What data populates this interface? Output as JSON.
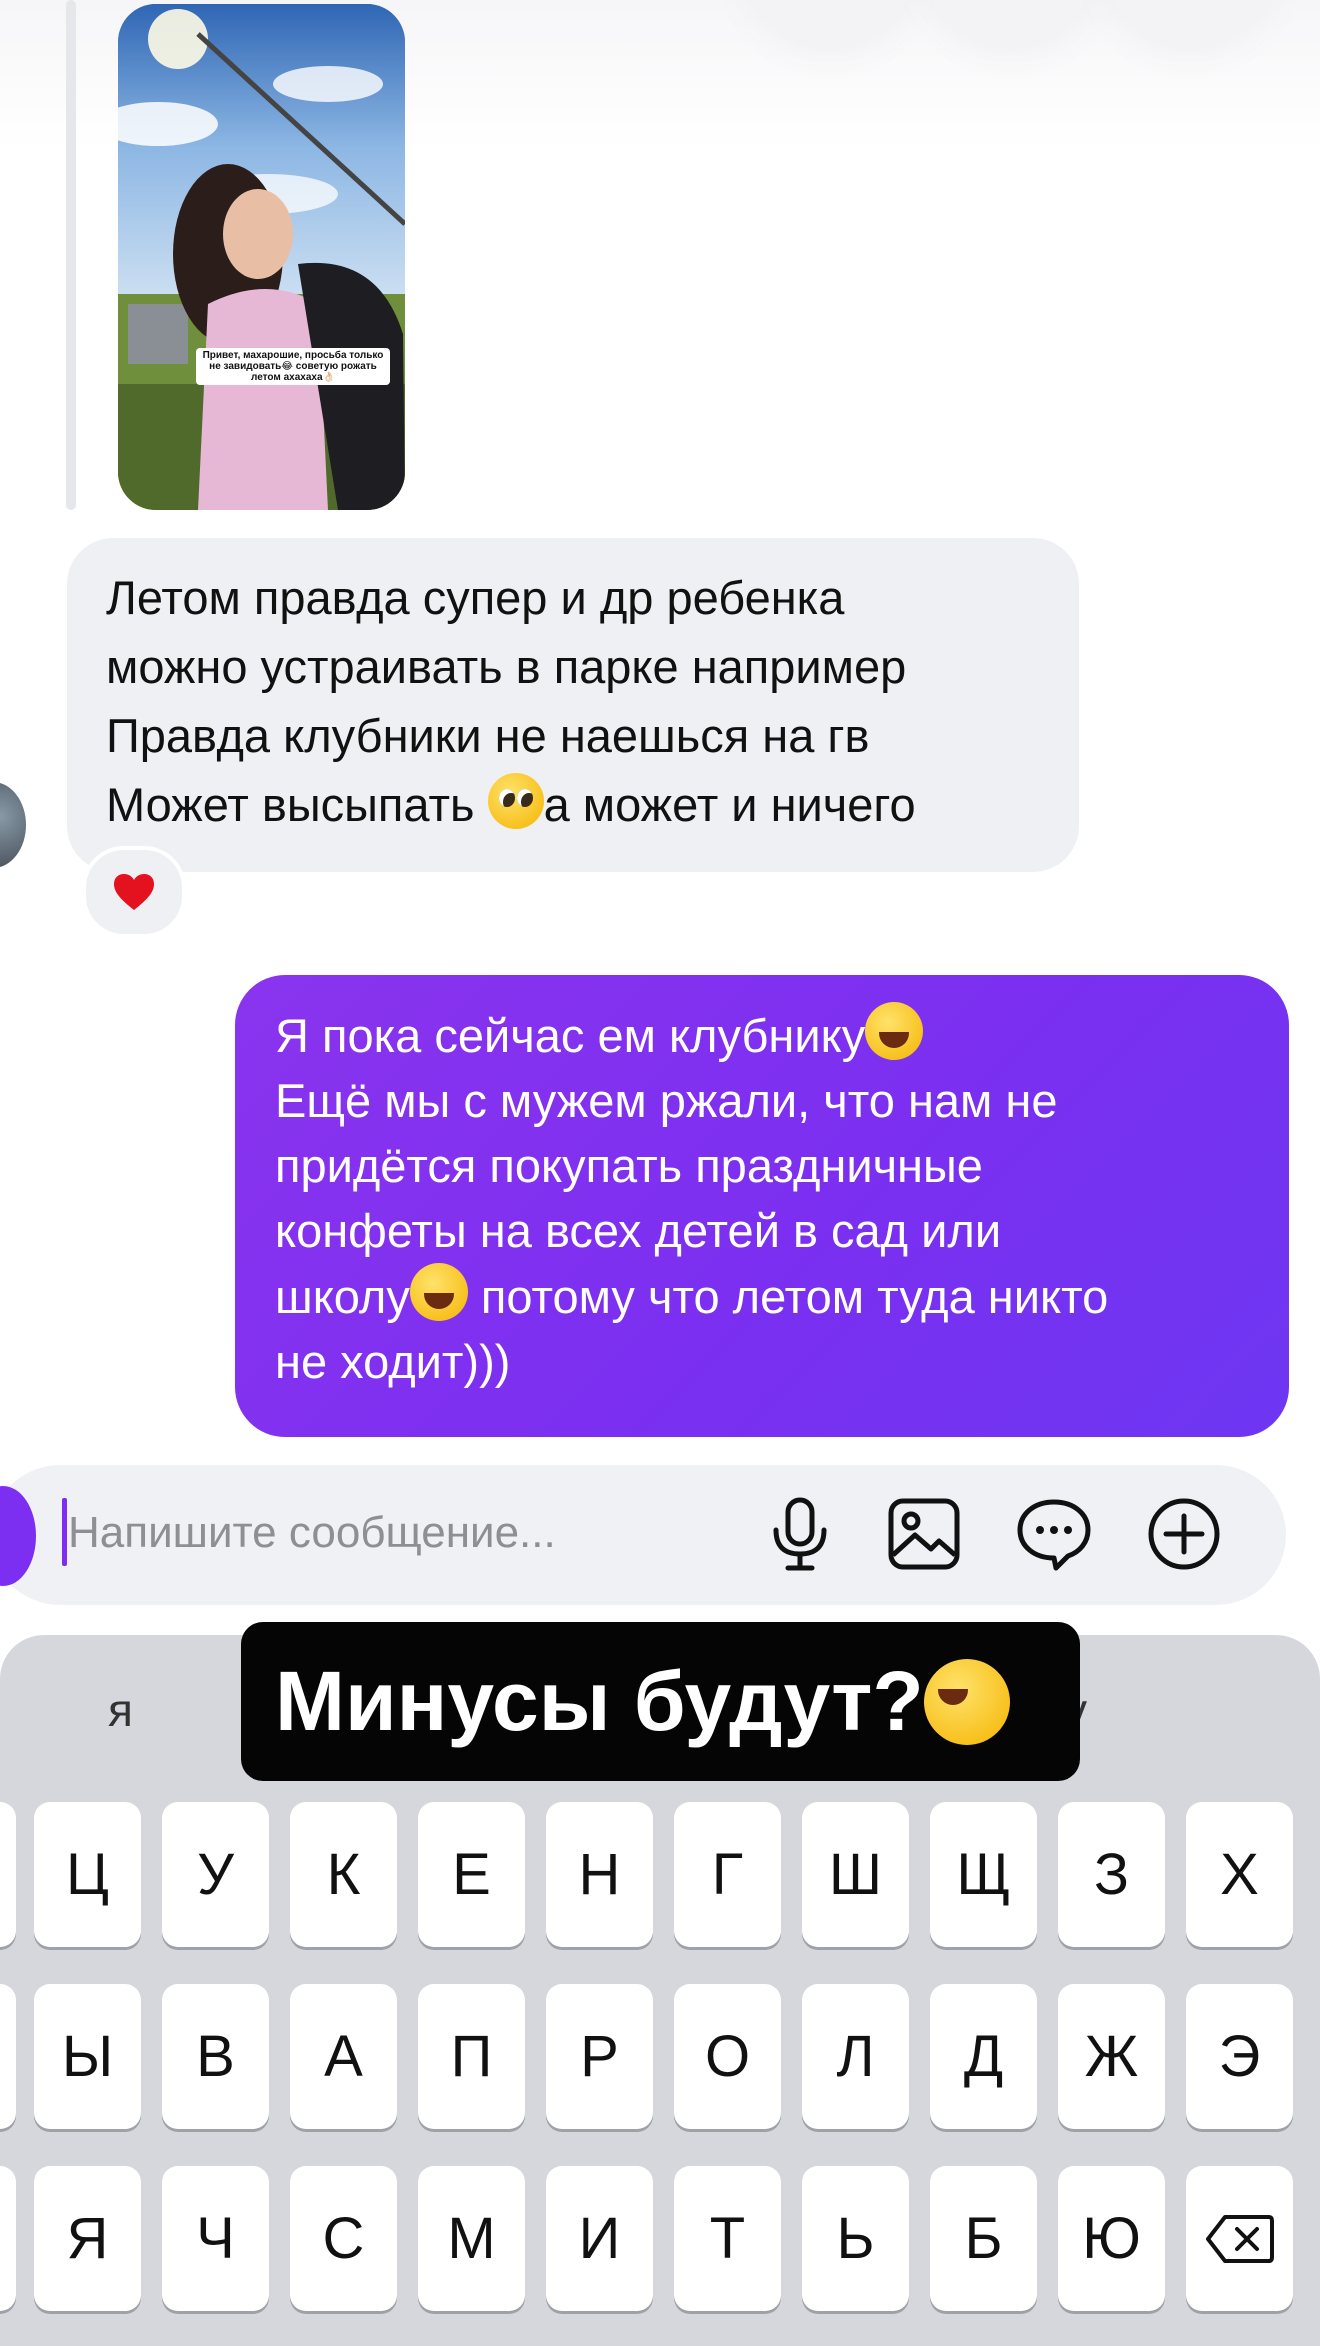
{
  "story": {
    "caption": "Привет, махарошие, просьба только не завидовать😂 советую рожать летом ахахаха👌🏻"
  },
  "received_message": {
    "lines": [
      "Летом правда супер и др ребенка",
      "можно устраивать в парке например",
      "Правда клубники не наешься на гв"
    ],
    "last_line_before": "Может высыпать ",
    "last_line_emoji": "pleading-face-emoji",
    "last_line_after": "а может и ничего",
    "reaction": "❤️"
  },
  "sent_message": {
    "line1": "Я пока сейчас ем клубнику",
    "line1_emoji": "tears-of-joy-emoji",
    "line2": "Ещё мы с мужем ржали, что нам не",
    "line3": "придётся покупать праздничные",
    "line4": "конфеты на всех детей в сад или",
    "line5_before": "школу",
    "line5_emoji": "rofl-emoji",
    "line5_after": " потому что летом туда никто",
    "line6": "не ходит)))"
  },
  "composer": {
    "placeholder": "Напишите сообщение...",
    "icons": [
      "microphone-icon",
      "image-icon",
      "sticker-icon",
      "plus-icon"
    ]
  },
  "keyboard": {
    "suggestion_left": "я",
    "suggestion_right": "у",
    "overlay_text": "Минусы будут?",
    "overlay_emoji": "rofl-emoji",
    "row1": [
      "Ц",
      "У",
      "К",
      "Е",
      "Н",
      "Г",
      "Ш",
      "Щ",
      "З",
      "Х"
    ],
    "row2": [
      "Ы",
      "В",
      "А",
      "П",
      "Р",
      "О",
      "Л",
      "Д",
      "Ж",
      "Э"
    ],
    "row3": [
      "Я",
      "Ч",
      "С",
      "М",
      "И",
      "Т",
      "Ь",
      "Б",
      "Ю"
    ]
  },
  "colors": {
    "sent_bubble": "#7b2ff0",
    "received_bubble": "#eef0f3",
    "keyboard_bg": "#d5d7dd"
  }
}
